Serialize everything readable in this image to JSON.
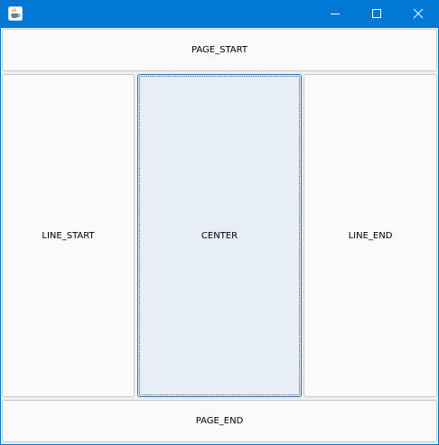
{
  "window": {
    "title": "",
    "app_icon": "java-coffee-cup-icon",
    "controls": {
      "minimize_icon": "minimize-icon",
      "maximize_icon": "maximize-icon",
      "close_icon": "close-icon"
    },
    "accent_color": "#0078d4"
  },
  "layout_buttons": {
    "page_start": "PAGE_START",
    "line_start": "LINE_START",
    "center": "CENTER",
    "line_end": "LINE_END",
    "page_end": "PAGE_END"
  },
  "focused_button": "center"
}
